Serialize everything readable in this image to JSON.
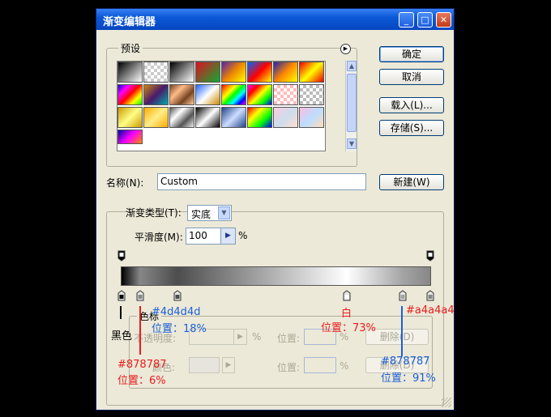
{
  "window": {
    "title": "渐变编辑器",
    "min": "_",
    "max": "□",
    "close": "✕"
  },
  "presets": {
    "label": "预设",
    "menu_icon": "circle-arrow-icon"
  },
  "buttons": {
    "ok": "确定",
    "cancel": "取消",
    "load": "载入(L)...",
    "save": "存储(S)...",
    "new": "新建(W)"
  },
  "name": {
    "label": "名称(N):",
    "value": "Custom"
  },
  "gradient": {
    "type_label": "渐变类型(T):",
    "type_value": "实底",
    "smooth_label": "平滑度(M):",
    "smooth_value": "100",
    "smooth_unit": "%",
    "stops": {
      "label": "色标"
    },
    "opacity_label": "不透明度:",
    "opacity_unit": "%",
    "opacity_pos_label": "位置:",
    "opacity_pos_unit": "%",
    "opacity_delete": "删除(D)",
    "color_label": "颜色:",
    "color_pos_label": "位置:",
    "color_pos_unit": "%",
    "color_delete": "删除(D)"
  },
  "annotations": {
    "black": "黑色",
    "c1": "#878787",
    "c1_pos": "位置：6%",
    "c2": "#4d4d4d",
    "c2_pos": "位置：18%",
    "white": "白",
    "white_pos": "位置：73%",
    "c4": "#a4a4a4",
    "c5": "#878787",
    "c5_pos": "位置：91%"
  },
  "colors": {
    "accent": "#0a58d6",
    "annot_red": "#e81c1c",
    "annot_blue": "#1b5fd6"
  }
}
